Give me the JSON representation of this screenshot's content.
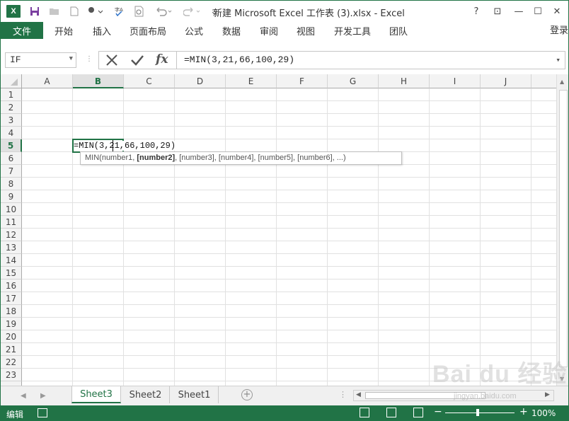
{
  "app": {
    "logo_letter": "X",
    "title": "新建 Microsoft Excel 工作表 (3).xlsx - Excel",
    "accent": "#217346"
  },
  "quick_access": {
    "icons": [
      "save-icon",
      "open-icon",
      "new-icon",
      "touch-mode-icon",
      "spelling-icon",
      "print-preview-icon",
      "undo-icon",
      "redo-icon",
      "customize-icon"
    ]
  },
  "window_buttons": {
    "help": "?",
    "restore_ribbon": "⊡",
    "minimize": "—",
    "maximize": "☐",
    "close": "✕"
  },
  "ribbon": {
    "file_tab": "文件",
    "tabs": [
      "开始",
      "插入",
      "页面布局",
      "公式",
      "数据",
      "审阅",
      "视图",
      "开发工具",
      "团队"
    ],
    "login": "登录"
  },
  "formula_bar": {
    "name_box": "IF",
    "formula": "=MIN(3,21,66,100,29)"
  },
  "grid": {
    "columns": [
      "A",
      "B",
      "C",
      "D",
      "E",
      "F",
      "G",
      "H",
      "I",
      "J"
    ],
    "active_column": "B",
    "rows": [
      "1",
      "2",
      "3",
      "4",
      "5",
      "6",
      "7",
      "8",
      "9",
      "10",
      "11",
      "12",
      "13",
      "14",
      "15",
      "16",
      "17",
      "18",
      "19",
      "20",
      "21",
      "22",
      "23"
    ],
    "active_row": "5",
    "active_cell_text": "=MIN(3,21,66,100,29)"
  },
  "tooltip": {
    "prefix": "MIN(number1, ",
    "bold": "[number2]",
    "suffix": ", [number3], [number4], [number5], [number6], ...)"
  },
  "sheets": {
    "tabs": [
      "Sheet3",
      "Sheet2",
      "Sheet1"
    ],
    "active": "Sheet3",
    "add_symbol": "+"
  },
  "status": {
    "mode": "编辑",
    "zoom": "100%"
  },
  "watermark": {
    "text": "Bai du 经验",
    "sub": "jingyan.baidu.com"
  }
}
